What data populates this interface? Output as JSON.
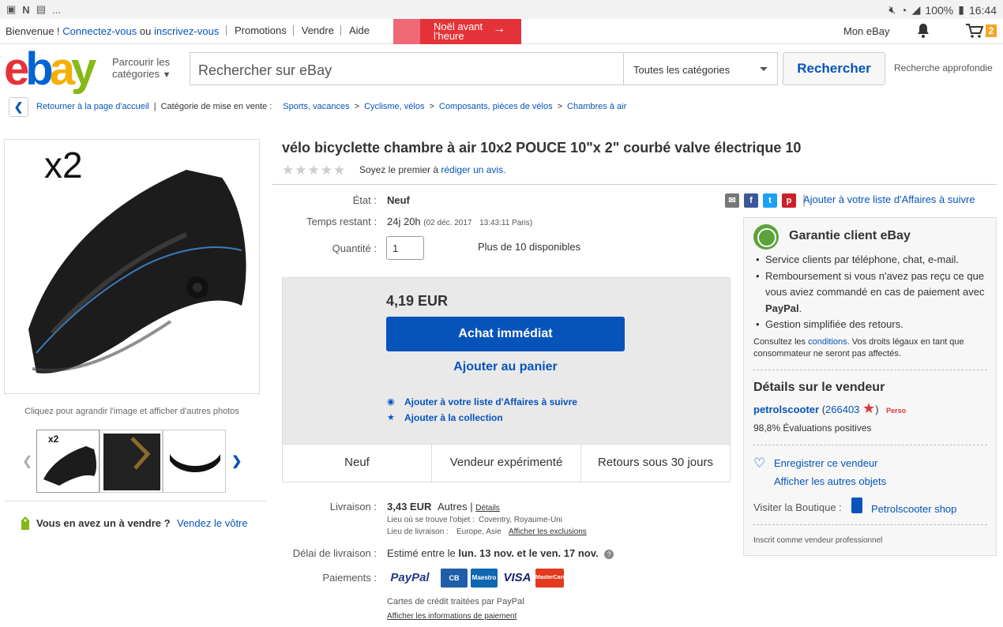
{
  "statusbar": {
    "battery": "100%",
    "time": "16:44",
    "notif_more": "..."
  },
  "topnav": {
    "welcome": "Bienvenue !",
    "login": "Connectez-vous",
    "or": "ou",
    "register": "inscrivez-vous",
    "menu": [
      "Promotions",
      "Vendre",
      "Aide"
    ],
    "banner_line1": "Noël avant",
    "banner_line2": "l'heure",
    "my_ebay": "Mon eBay",
    "cart_count": "2"
  },
  "header": {
    "logo_letters": [
      "e",
      "b",
      "a",
      "y"
    ],
    "shop_by_line1": "Parcourir les",
    "shop_by_line2": "catégories",
    "search_placeholder": "Rechercher sur eBay",
    "category": "Toutes les catégories",
    "search_button": "Rechercher",
    "advanced": "Recherche approfondie"
  },
  "breadcrumb": {
    "back": "Retourner à la page d'accueil",
    "label": "Catégorie de mise en vente :",
    "items": [
      "Sports, vacances",
      "Cyclisme, vélos",
      "Composants, pièces de vélos",
      "Chambres à air"
    ]
  },
  "gallery": {
    "main_overlay": "x2",
    "enlarge_text": "Cliquez pour agrandir l'image et afficher d'autres photos",
    "thumb1_label": "x2"
  },
  "sell": {
    "question": "Vous en avez un à vendre ?",
    "link": "Vendez le vôtre"
  },
  "product": {
    "title": "vélo bicyclette chambre à air 10x2 POUCE 10\"x 2\" courbé valve électrique 10",
    "rating_stars": 0,
    "review_prefix": "Soyez le premier à",
    "review_link": "rédiger un avis.",
    "condition_label": "État :",
    "condition": "Neuf",
    "time_label": "Temps restant :",
    "time_left": "24j 20h",
    "end_date": "(02 déc. 2017",
    "end_time": "13:43:11 Paris)",
    "qty_label": "Quantité :",
    "qty_value": "1",
    "available": "Plus de 10 disponibles",
    "price": "4,19 EUR",
    "buy_now": "Achat immédiat",
    "add_to_cart": "Ajouter au panier",
    "watch": "Ajouter à votre liste d'Affaires à suivre",
    "collection": "Ajouter à la collection",
    "tiles": [
      "Neuf",
      "Vendeur expérimenté",
      "Retours sous 30 jours"
    ]
  },
  "shipping": {
    "label": "Livraison :",
    "cost": "3,43 EUR",
    "method": "Autres",
    "details": "Détails",
    "location_label": "Lieu où se trouve l'objet :",
    "location": "Coventry, Royaume-Uni",
    "ships_to_label": "Lieu de livraison :",
    "ships_to": "Europe, Asie",
    "exclusions": "Afficher les exclusions",
    "delay_label": "Délai de livraison :",
    "delay_prefix": "Estimé entre le",
    "delay_from": "lun. 13 nov.",
    "delay_and": "et le",
    "delay_to": "ven. 17 nov."
  },
  "payments": {
    "label": "Paiements :",
    "paypal": "PayPal",
    "cb": "CB",
    "maestro": "Maestro",
    "visa": "VISA",
    "mastercard": "MasterCard",
    "note": "Cartes de crédit traitées par PayPal",
    "info_link": "Afficher les informations de paiement"
  },
  "share": {
    "watch_link": "Ajouter à votre liste d'Affaires à suivre"
  },
  "guarantee": {
    "title": "Garantie client eBay",
    "items": [
      "Service clients par téléphone, chat, e-mail.",
      "Remboursement si vous n'avez pas reçu ce que vous aviez commandé en cas de paiement avec PayPal.",
      "Gestion simplifiée des retours."
    ],
    "paypal_word": "PayPal",
    "note_prefix": "Consultez les",
    "note_link": "conditions",
    "note_suffix": ". Vos droits légaux en tant que consommateur ne seront pas affectés."
  },
  "seller": {
    "title": "Détails sur le vendeur",
    "name": "petrolscooter",
    "score": "266403",
    "badge": "Perso",
    "feedback": "98,8% Évaluations positives",
    "save": "Enregistrer ce vendeur",
    "other_items": "Afficher les autres objets",
    "visit_shop": "Visiter la Boutique :",
    "shop_name": "Petrolscooter shop",
    "pro": "Inscrit comme vendeur professionnel"
  },
  "colors": {
    "link": "#0654ba",
    "buy_button": "#0654ba",
    "banner": "#e53238",
    "guarantee_green": "#5ba33a",
    "cart_badge": "#f5a623"
  }
}
